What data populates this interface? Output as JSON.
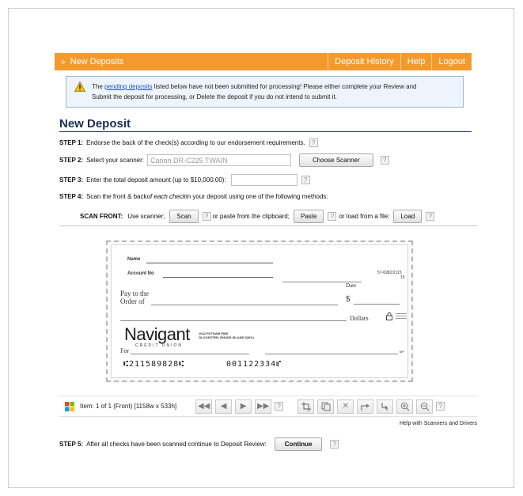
{
  "header": {
    "title": "New Deposits",
    "nav": [
      "Deposit History",
      "Help",
      "Logout"
    ]
  },
  "alert": {
    "prefix": "The ",
    "link": "pending deposits",
    "text1": " listed below have not been submitted for processing! Please either complete your Review and",
    "text2": "Submit the deposit for processing, or Delete the deposit if you do not intend to submit it."
  },
  "section_title": "New Deposit",
  "steps": {
    "step1": {
      "label": "STEP 1:",
      "text": "Endorse the back of the check(s) according to our endorsement requirements."
    },
    "step2": {
      "label": "STEP 2:",
      "text": "Select your scanner:",
      "scanner_value": "Canon DR-C225 TWAIN",
      "button": "Choose Scanner"
    },
    "step3": {
      "label": "STEP 3:",
      "text": "Enter the total deposit amount (up to $10,000.00):",
      "amount_value": ""
    },
    "step4": {
      "label": "STEP 4:",
      "text_a": "Scan the front & back ",
      "text_b": "of each check",
      "text_c": " in your deposit using one of the following methods:"
    },
    "scan_front": {
      "label": "SCAN FRONT:",
      "use_scanner": "Use scanner;",
      "scan_button": "Scan",
      "paste_text": "or paste from the clipboard;",
      "paste_button": "Paste",
      "load_text": "or load from a file;",
      "load_button": "Load"
    },
    "step5": {
      "label": "STEP 5:",
      "text": "After all checks have been scanned continue to Deposit Review:",
      "button": "Continue"
    }
  },
  "help_glyph": "?",
  "check": {
    "name_label": "Name",
    "account_label": "Account No",
    "routing_fraction": "57-6982/2115",
    "routing_sub": "15",
    "date_label": "Date",
    "pay_to": "Pay to the",
    "order_of": "Order of",
    "dollar_sign": "$",
    "dollars_label": "Dollars",
    "bank_name": "Navigant",
    "bank_sub": "CREDIT UNION",
    "bank_addr1": "1042 PUTNAM PIKE",
    "bank_addr2": "GLOCESTER, RHODE ISLAND 02814",
    "for_label": "For",
    "mp": "MP",
    "micr_routing": "⑆211589828⑆",
    "micr_account": "001122334⑈"
  },
  "viewer": {
    "item_text": "Item: 1 of 1 (Front)  [1158w x 533h]"
  },
  "help_link": "Help with Scanners and Drivers",
  "icons": {
    "first": "first-page-icon",
    "prev": "prev-page-icon",
    "next": "next-page-icon",
    "last": "last-page-icon",
    "crop": "crop-icon",
    "copy": "copy-icon",
    "delete": "delete-icon",
    "rotate": "rotate-icon",
    "flip": "flip-icon",
    "zoom_in": "zoom-in-icon",
    "zoom_out": "zoom-out-icon"
  },
  "colors": {
    "header": "#f39a2f",
    "title": "#1b2f57",
    "alert_bg": "#eef4fb",
    "link": "#1a55c9"
  }
}
